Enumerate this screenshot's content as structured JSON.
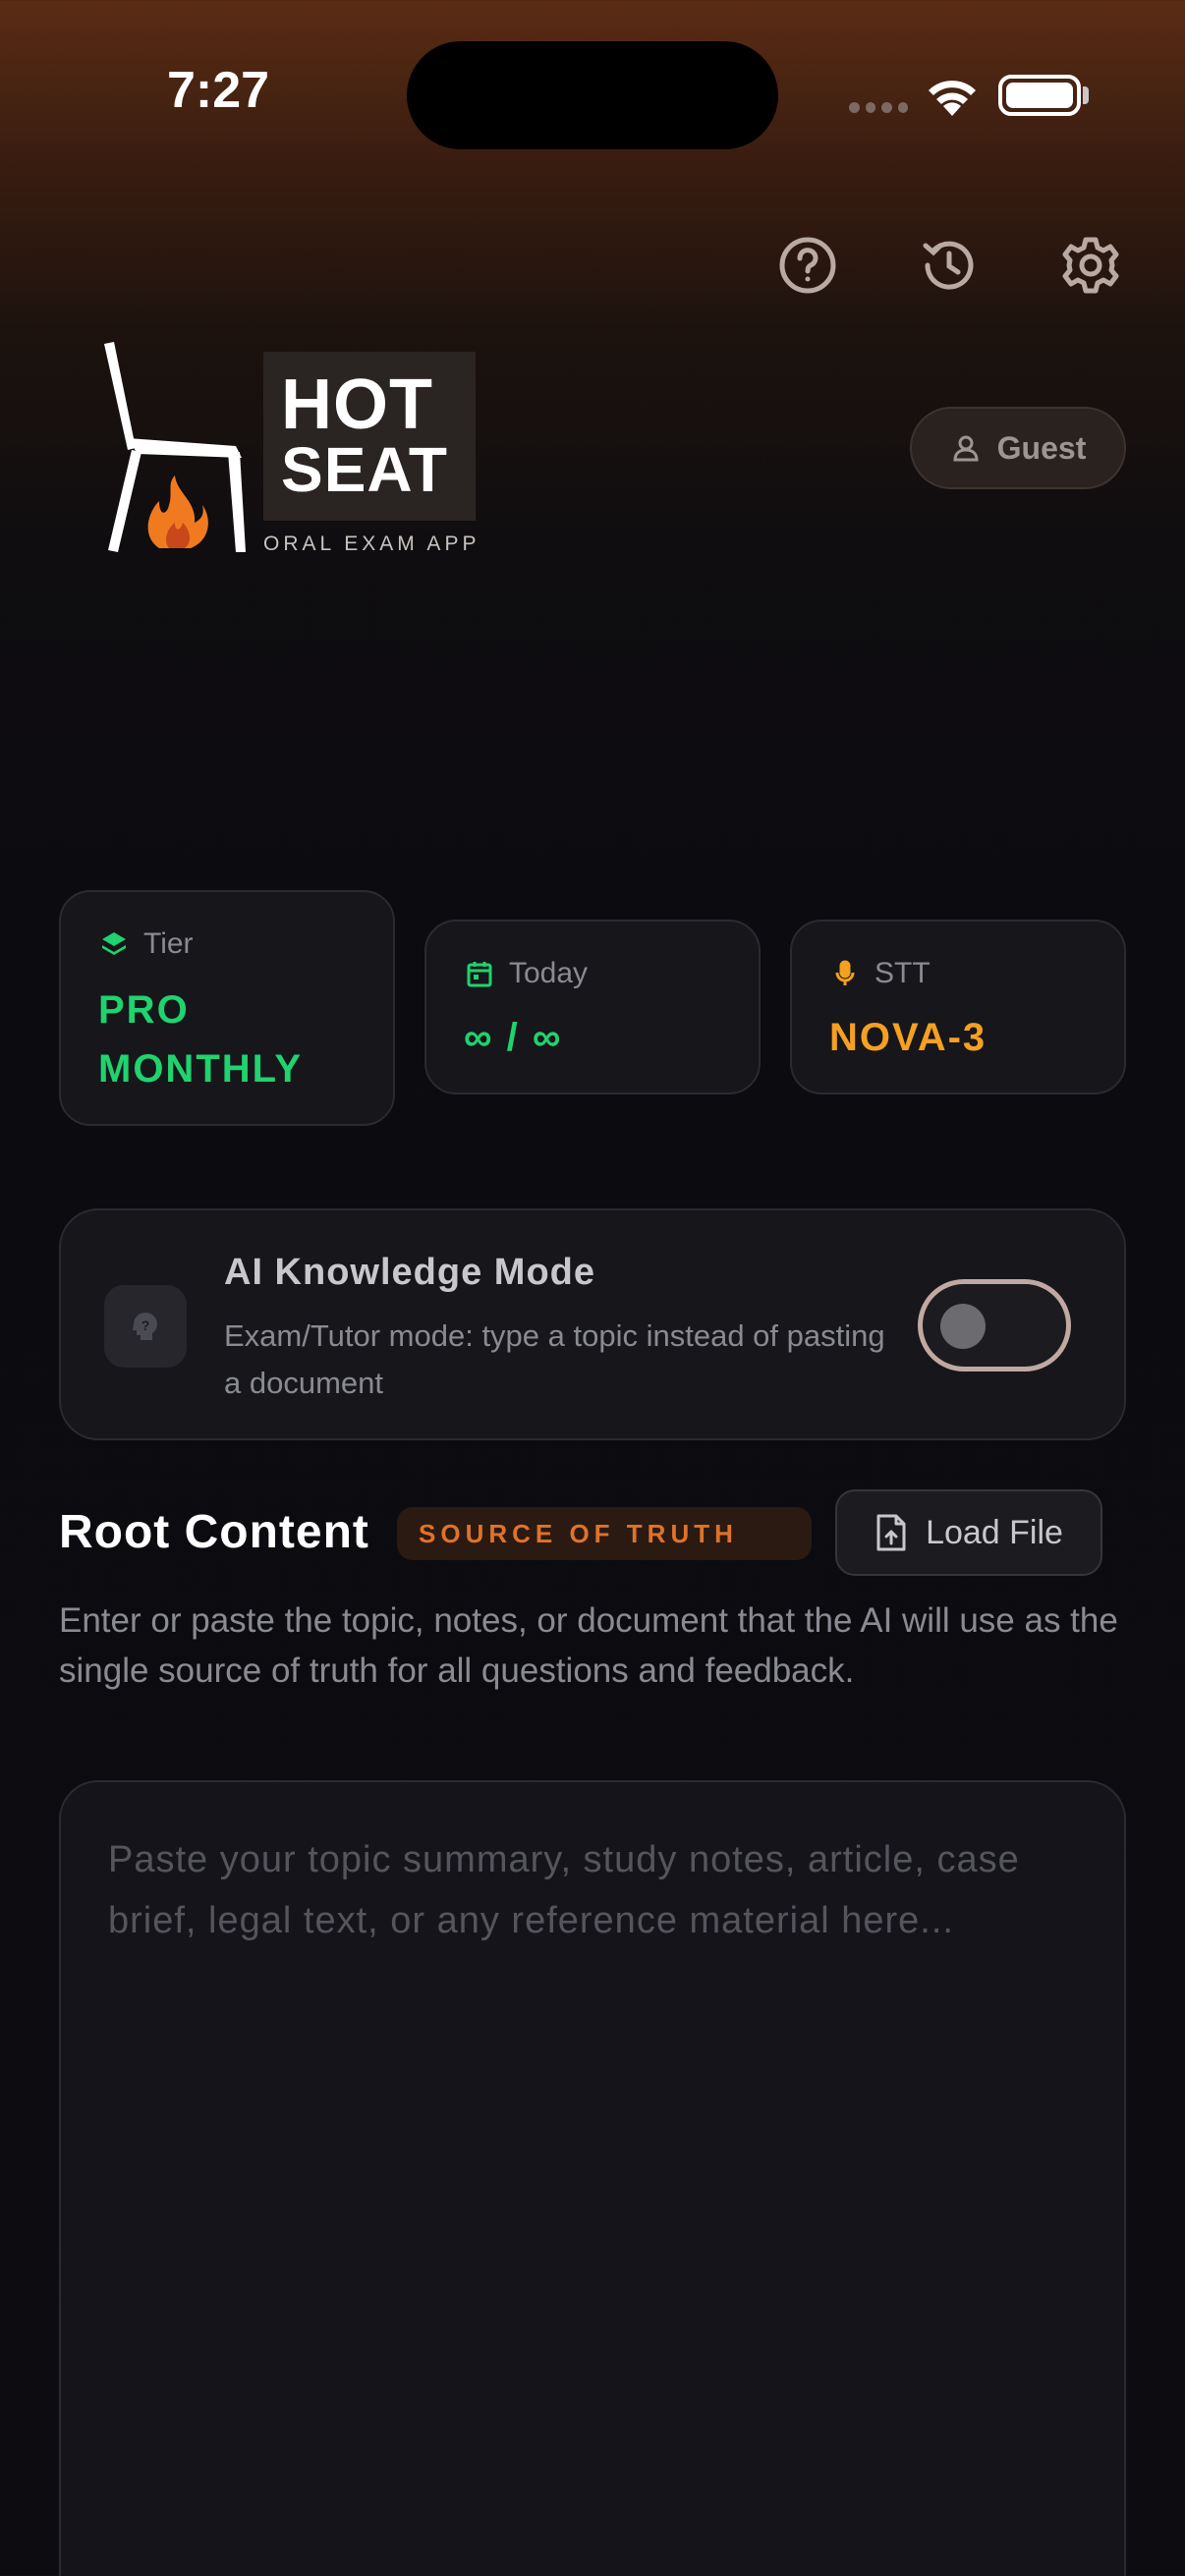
{
  "status_bar": {
    "time": "7:27"
  },
  "header": {
    "icons": [
      "help-circle-icon",
      "history-icon",
      "settings-gear-icon"
    ]
  },
  "logo": {
    "line1": "HOT",
    "line2": "SEAT",
    "tagline": "ORAL EXAM APP"
  },
  "user": {
    "label": "Guest"
  },
  "stats": {
    "tier": {
      "label": "Tier",
      "value_line1": "PRO",
      "value_line2": "MONTHLY",
      "color": "#1fd36e"
    },
    "today": {
      "label": "Today",
      "value": "∞ / ∞",
      "color": "#1fd36e"
    },
    "stt": {
      "label": "STT",
      "value": "NOVA-3",
      "color": "#f5a020"
    }
  },
  "ai_mode": {
    "title": "AI Knowledge Mode",
    "description": "Exam/Tutor mode: type a topic instead of pasting a document",
    "enabled": false
  },
  "root_content": {
    "title": "Root Content",
    "badge": "SOURCE OF TRUTH",
    "load_button": "Load File",
    "description": "Enter or paste the topic, notes, or document that the AI will use as the single source of truth for all questions and feedback.",
    "value": "",
    "placeholder": "Paste your topic summary, study notes, article, case brief, legal text, or any reference material here..."
  },
  "colors": {
    "accent_green": "#1fd36e",
    "accent_orange": "#f5a020",
    "badge_orange": "#e0722a"
  }
}
